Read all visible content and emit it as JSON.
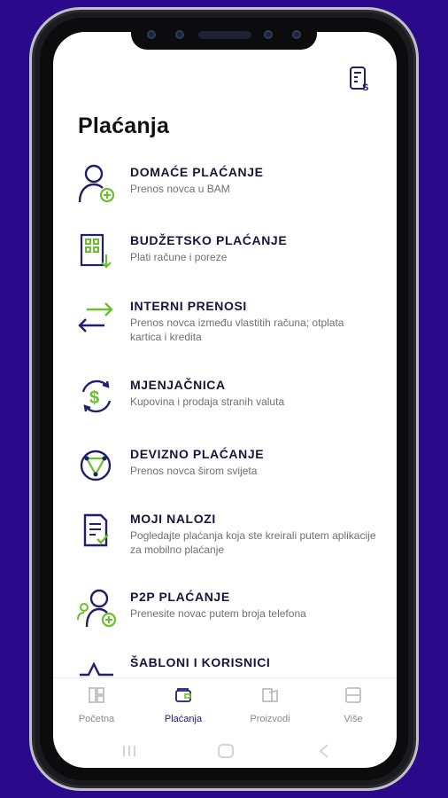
{
  "page": {
    "title": "Plaćanja"
  },
  "items": [
    {
      "title": "DOMAĆE PLAĆANJE",
      "subtitle": "Prenos novca u BAM",
      "icon": "person-add-icon"
    },
    {
      "title": "BUDŽETSKO PLAĆANJE",
      "subtitle": "Plati račune i poreze",
      "icon": "building-icon"
    },
    {
      "title": "INTERNI PRENOSI",
      "subtitle": "Prenos novca između vlastitih računa; otplata kartica i kredita",
      "icon": "transfer-arrows-icon"
    },
    {
      "title": "MJENJAČNICA",
      "subtitle": "Kupovina i prodaja stranih valuta",
      "icon": "currency-exchange-icon"
    },
    {
      "title": "DEVIZNO PLAĆANJE",
      "subtitle": "Prenos novca širom svijeta",
      "icon": "globe-transfer-icon"
    },
    {
      "title": "MOJI NALOZI",
      "subtitle": "Pogledajte plaćanja koja ste kreirali putem aplikacije za mobilno plaćanje",
      "icon": "document-check-icon"
    },
    {
      "title": "P2P PLAĆANJE",
      "subtitle": "Prenesite novac putem broja telefona",
      "icon": "p2p-icon"
    },
    {
      "title": "ŠABLONI I KORISNICI",
      "subtitle": "",
      "icon": "template-icon"
    }
  ],
  "nav": [
    {
      "label": "Početna",
      "icon": "home-icon"
    },
    {
      "label": "Plaćanja",
      "icon": "wallet-icon"
    },
    {
      "label": "Proizvodi",
      "icon": "products-icon"
    },
    {
      "label": "Više",
      "icon": "more-icon"
    }
  ],
  "colors": {
    "primary": "#1f1f6b",
    "accent": "#6cbf2c",
    "background": "#2a0a8a"
  }
}
